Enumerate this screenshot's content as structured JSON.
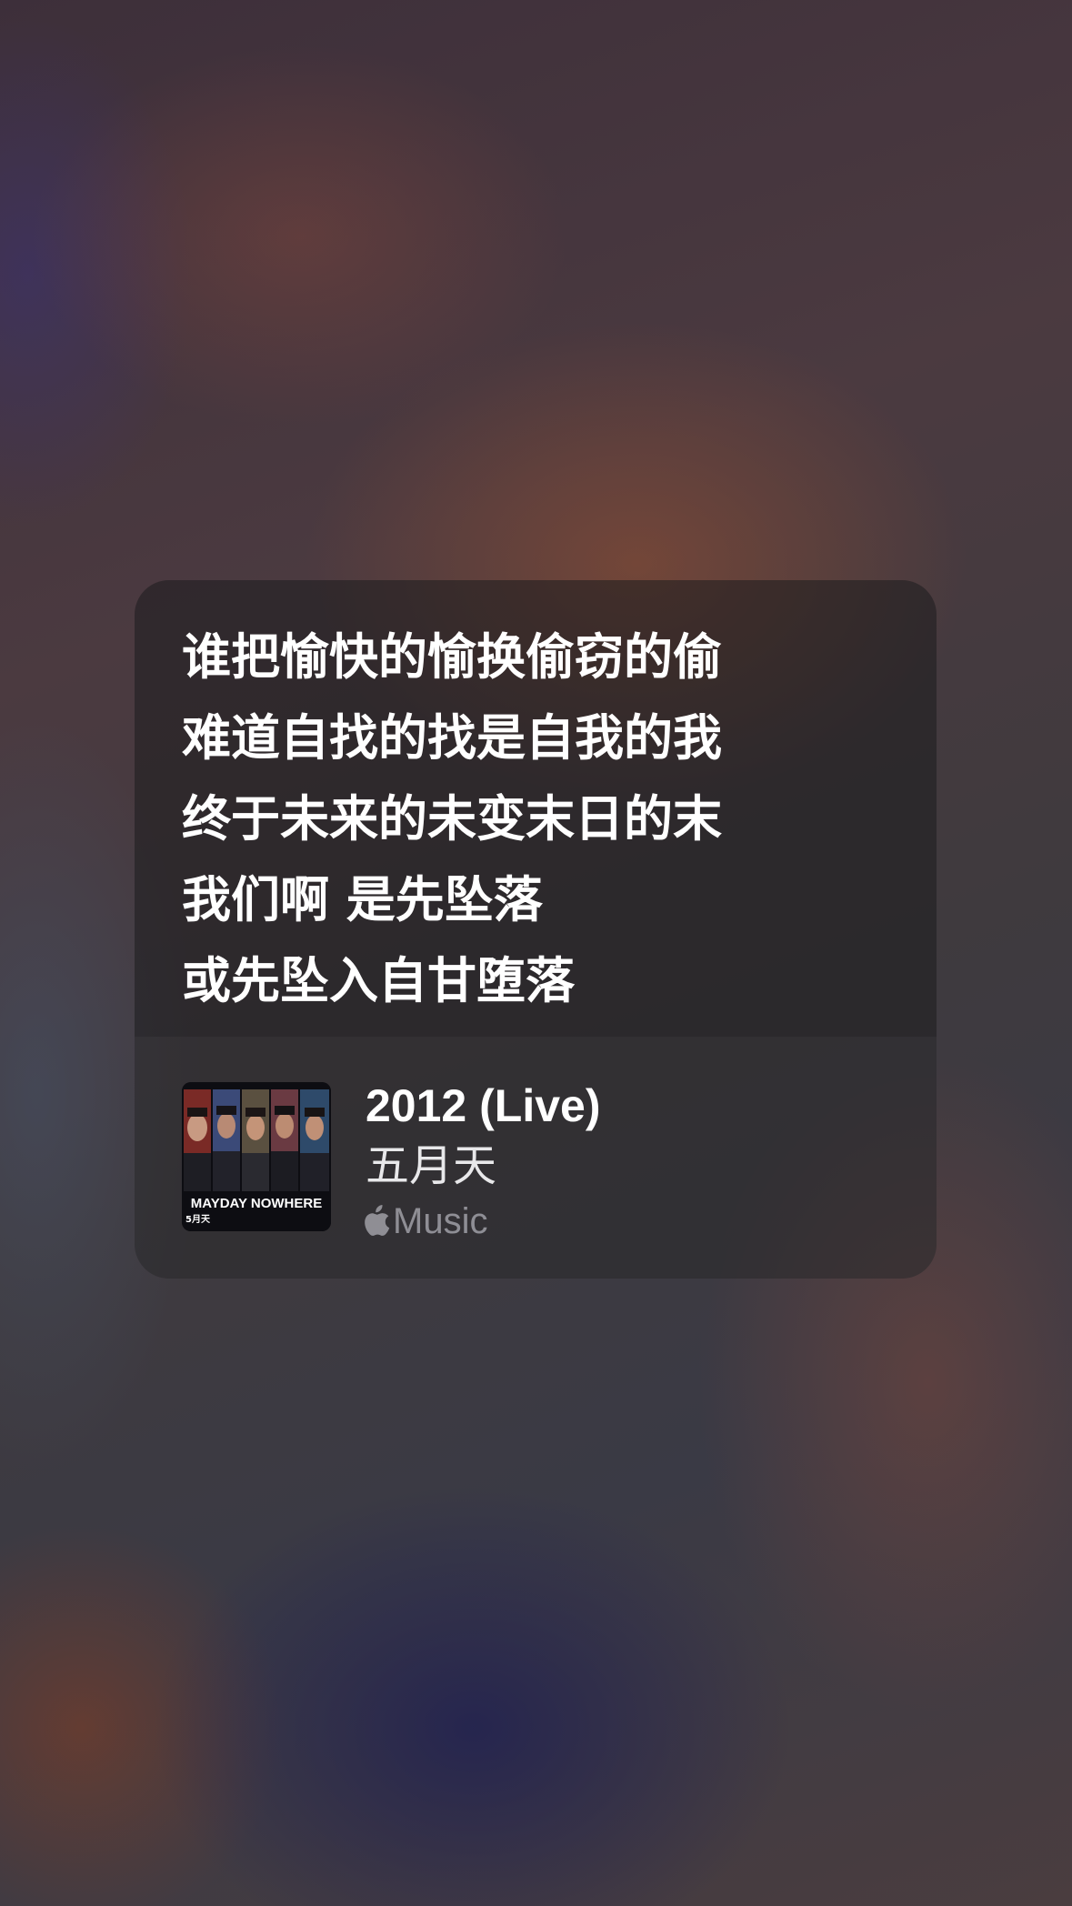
{
  "lyrics": {
    "lines": [
      "谁把愉快的愉换偷窃的偷",
      "难道自找的找是自我的我",
      "终于未来的未变末日的末",
      "我们啊 是先坠落",
      "或先坠入自甘堕落"
    ]
  },
  "now_playing": {
    "title": "2012 (Live)",
    "artist": "五月天",
    "source_label": "Music",
    "source_icon": "apple-logo-icon",
    "artwork": {
      "caption": "MAYDAY NOWHERE",
      "sub_caption": "5月天"
    }
  },
  "colors": {
    "text_primary": "#ffffff",
    "text_secondary": "#8e8e93",
    "card_background": "rgba(28,28,30,0.55)"
  }
}
